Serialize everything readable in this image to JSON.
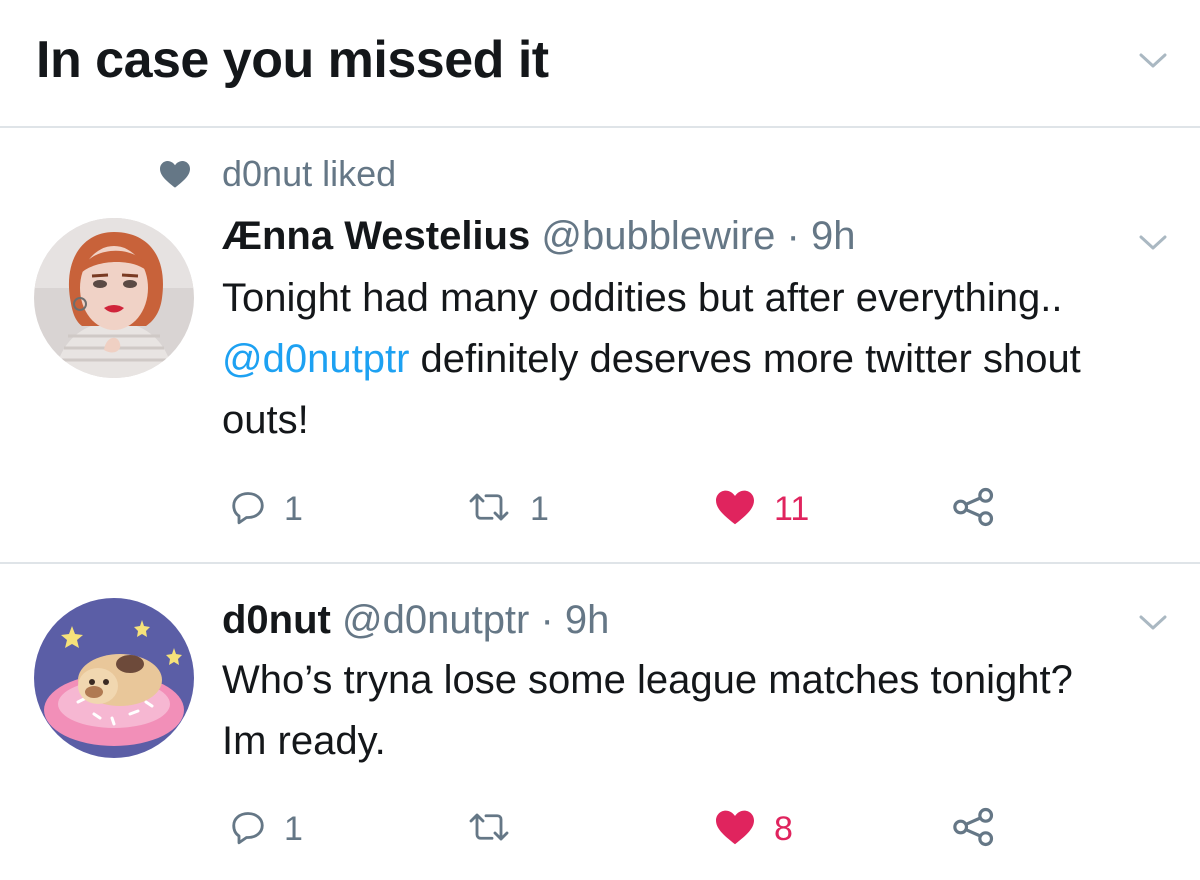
{
  "header": {
    "title": "In case you missed it"
  },
  "colors": {
    "text": "#14171a",
    "secondary": "#657786",
    "link": "#1da1f2",
    "like": "#e0245e",
    "divider": "#dfe4e8"
  },
  "tweets": [
    {
      "social_context": "d0nut liked",
      "social_context_icon": "heart-icon",
      "name": "Ænna Westelius",
      "handle": "@bubblewire",
      "separator": "·",
      "time": "9h",
      "text_before": "Tonight had many oddities but after everything.. ",
      "mention": "@d0nutptr",
      "text_after": " definitely deserves more twitter shout outs!",
      "replies": "1",
      "retweets": "1",
      "likes": "11",
      "liked": true
    },
    {
      "name": "d0nut",
      "handle": "@d0nutptr",
      "separator": "·",
      "time": "9h",
      "text": "Who’s tryna lose some league matches tonight? Im ready.",
      "replies": "1",
      "retweets": "",
      "likes": "8",
      "liked": true
    }
  ]
}
